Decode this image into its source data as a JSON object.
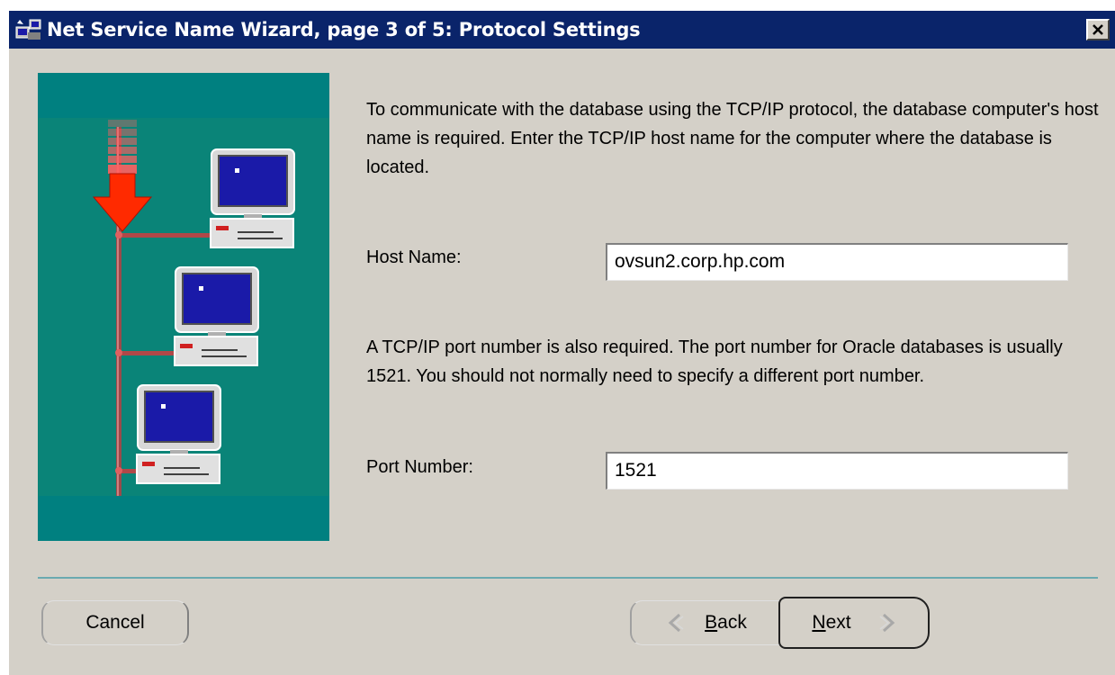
{
  "window": {
    "title": "Net Service Name Wizard, page 3 of 5: Protocol Settings",
    "title_icon": "wizard-app-icon",
    "close_glyph": "×"
  },
  "illustration": {
    "description_icon": "network-computers-illustration",
    "colors": {
      "background": "#008080",
      "arrow": "#ff2a00",
      "screen": "#1a1aa8"
    }
  },
  "content": {
    "intro_text": "To communicate with the database using the TCP/IP protocol, the database computer's host name is required.  Enter the TCP/IP host name for the computer where the database is located.",
    "host_label": "Host Name:",
    "host_value": "ovsun2.corp.hp.com",
    "port_text": "A TCP/IP port number is also required.  The port number for Oracle databases is usually 1521.  You should not normally need to specify a different port number.",
    "port_label": "Port Number:",
    "port_value": "1521"
  },
  "buttons": {
    "cancel": "Cancel",
    "back_mnemonic": "B",
    "back_rest": "ack",
    "back_icon": "chevron-left-icon",
    "next_mnemonic": "N",
    "next_rest": "ext",
    "next_icon": "chevron-right-icon"
  }
}
